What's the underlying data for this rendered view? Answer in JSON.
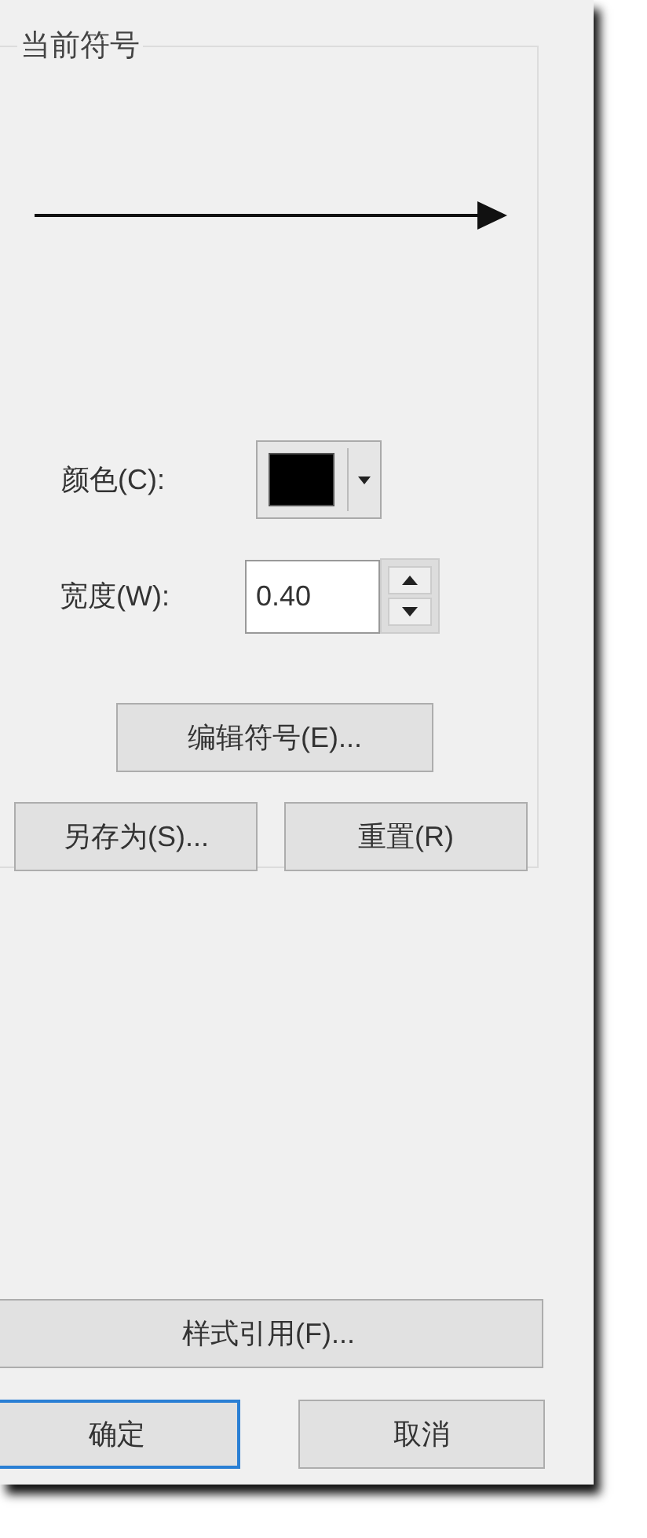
{
  "group": {
    "title": "当前符号"
  },
  "color": {
    "label": "颜色(C):",
    "color": "#000000"
  },
  "width": {
    "label": "宽度(W):",
    "value": "0.40"
  },
  "symbol_buttons": [
    {
      "label": "编辑符号(E)..."
    },
    {
      "label": "另存为(S)..."
    },
    {
      "label": "重置(R)"
    }
  ],
  "style_button": {
    "label": "样式引用(F)..."
  },
  "dialog_buttons": [
    {
      "label": "确定",
      "focused": true
    },
    {
      "label": "取消",
      "focused": false
    }
  ]
}
